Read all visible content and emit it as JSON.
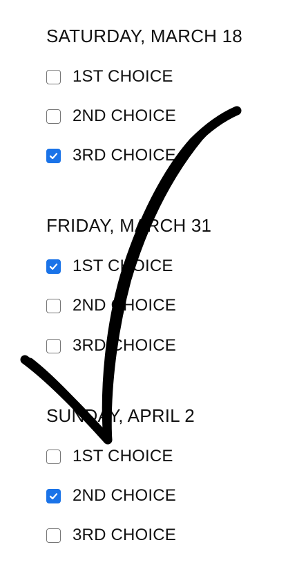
{
  "groups": [
    {
      "heading": "SATURDAY, MARCH 18",
      "options": [
        {
          "label": "1ST CHOICE",
          "checked": false
        },
        {
          "label": "2ND CHOICE",
          "checked": false
        },
        {
          "label": "3RD CHOICE",
          "checked": true
        }
      ]
    },
    {
      "heading": "FRIDAY, MARCH 31",
      "options": [
        {
          "label": "1ST CHOICE",
          "checked": true
        },
        {
          "label": "2ND CHOICE",
          "checked": false
        },
        {
          "label": "3RD CHOICE",
          "checked": false
        }
      ]
    },
    {
      "heading": "SUNDAY, APRIL 2",
      "options": [
        {
          "label": "1ST CHOICE",
          "checked": false
        },
        {
          "label": "2ND CHOICE",
          "checked": true
        },
        {
          "label": "3RD CHOICE",
          "checked": false
        }
      ]
    }
  ],
  "colors": {
    "checkbox_checked": "#1a73e8",
    "checkbox_border": "#767676",
    "text": "#111111",
    "overlay_stroke": "#000000"
  },
  "overlay": {
    "icon": "hand-drawn-checkmark-icon"
  }
}
